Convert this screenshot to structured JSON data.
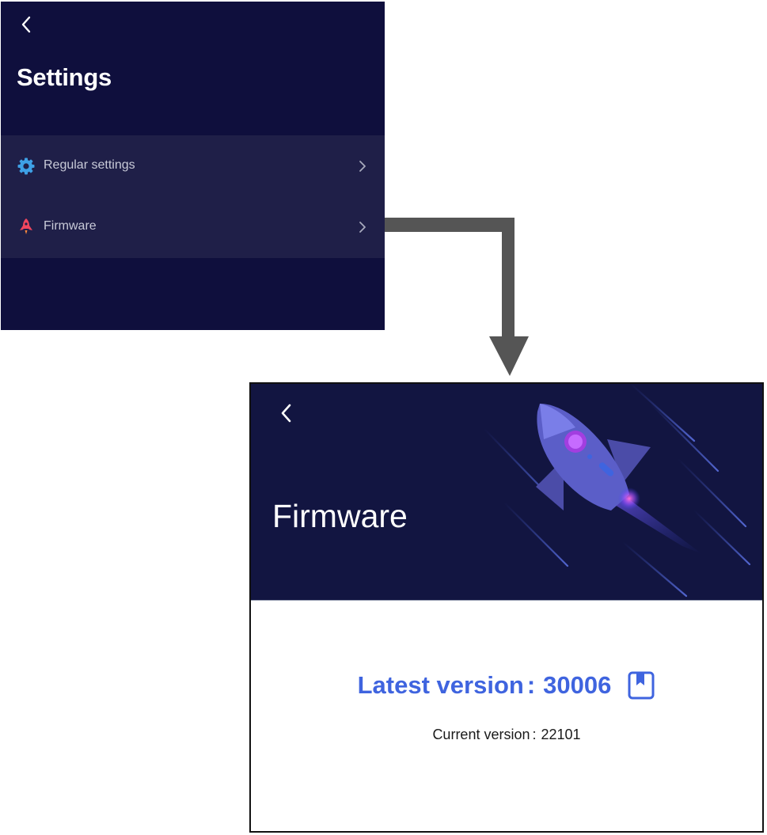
{
  "settings": {
    "title": "Settings",
    "items": [
      {
        "label": "Regular settings",
        "icon": "gear-icon"
      },
      {
        "label": "Firmware",
        "icon": "rocket-icon"
      }
    ]
  },
  "firmware": {
    "title": "Firmware",
    "latest_label": "Latest version",
    "latest_value": "30006",
    "current_label": "Current version",
    "current_value": "22101",
    "separator": ":"
  },
  "colors": {
    "settings_bg": "#0f0f3d",
    "menu_bg": "#1f1f48",
    "firmware_header_bg": "#121541",
    "accent_blue": "#3f64df",
    "connector_gray": "#555555"
  }
}
